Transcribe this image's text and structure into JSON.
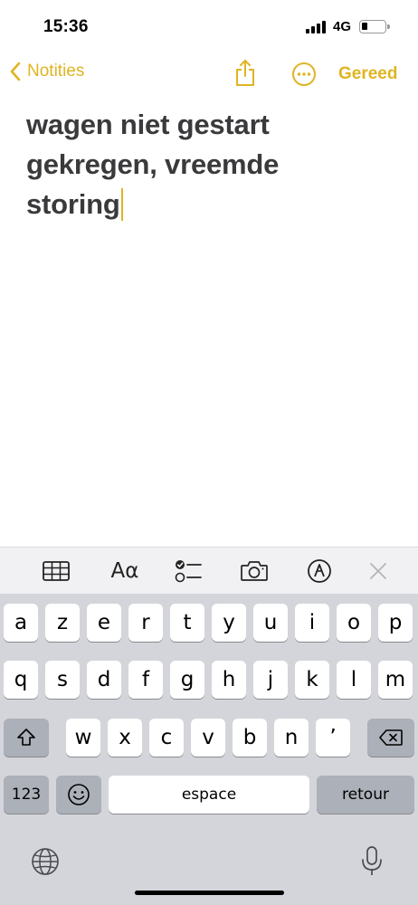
{
  "status": {
    "time": "15:36",
    "network": "4G"
  },
  "nav": {
    "back_label": "Notities",
    "done_label": "Gereed",
    "accent_color": "#e0b422"
  },
  "note": {
    "lines": [
      "wagen niet gestart",
      "gekregen, vreemde",
      "storing"
    ]
  },
  "toolbar": {
    "items": [
      "table-icon",
      "text-format",
      "checklist-icon",
      "camera-icon",
      "markup-icon",
      "close-icon"
    ],
    "format_label": "Aα"
  },
  "keyboard": {
    "row1": [
      "a",
      "z",
      "e",
      "r",
      "t",
      "y",
      "u",
      "i",
      "o",
      "p"
    ],
    "row2": [
      "q",
      "s",
      "d",
      "f",
      "g",
      "h",
      "j",
      "k",
      "l",
      "m"
    ],
    "row3": [
      "w",
      "x",
      "c",
      "v",
      "b",
      "n",
      "’"
    ],
    "numbers_label": "123",
    "space_label": "espace",
    "return_label": "retour"
  }
}
